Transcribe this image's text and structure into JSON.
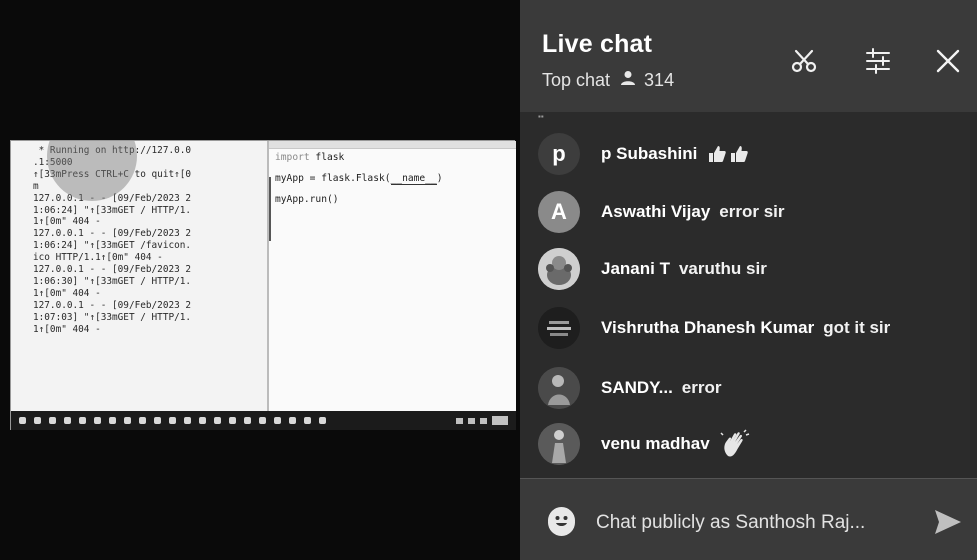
{
  "video": {
    "terminal_lines": [
      " * Running on http://127.0.0",
      ".1:5000",
      "↑[33mPress CTRL+C to quit↑[0",
      "m",
      "127.0.0.1 - - [09/Feb/2023 2",
      "1:06:24] \"↑[33mGET / HTTP/1.",
      "1↑[0m\" 404 -",
      "127.0.0.1 - - [09/Feb/2023 2",
      "1:06:24] \"↑[33mGET /favicon.",
      "ico HTTP/1.1↑[0m\" 404 -",
      "127.0.0.1 - - [09/Feb/2023 2",
      "1:06:30] \"↑[33mGET / HTTP/1.",
      "1↑[0m\" 404 -",
      "127.0.0.1 - - [09/Feb/2023 2",
      "1:07:03] \"↑[33mGET / HTTP/1.",
      "1↑[0m\" 404 -"
    ],
    "code": {
      "line1_keyword": "import",
      "line1_rest": " flask",
      "line2_prefix": "myApp = flask.Flask(",
      "line2_arg": "__name__",
      "line2_suffix": ")",
      "line3": "myApp.run()"
    }
  },
  "chat": {
    "title": "Live chat",
    "mode_label": "Top chat",
    "viewer_count": "314",
    "header_icons": [
      "scissors-icon",
      "settings-sliders-icon",
      "close-icon"
    ],
    "messages": [
      {
        "author": "p Subashini",
        "text": "",
        "avatar_letter": "p",
        "avatar_color": "#3d3d3d",
        "emoji": [
          "thumbs-up",
          "thumbs-up"
        ]
      },
      {
        "author": "Aswathi Vijay",
        "text": "error sir",
        "avatar_letter": "A",
        "avatar_color": "#8a8a8a",
        "emoji": []
      },
      {
        "author": "Janani T",
        "text": "varuthu sir",
        "avatar_letter": "",
        "avatar_color": "#cfcfcf",
        "emoji": []
      },
      {
        "author": "Vishrutha Dhanesh Kumar",
        "text": "got it sir",
        "avatar_letter": "",
        "avatar_color": "#1e1e1e",
        "emoji": []
      },
      {
        "author": "SANDY...",
        "text": "error",
        "avatar_letter": "",
        "avatar_color": "#4a4a4a",
        "emoji": []
      },
      {
        "author": "venu madhav",
        "text": "",
        "avatar_letter": "",
        "avatar_color": "#5a5a5a",
        "emoji": [
          "waving-hand"
        ]
      }
    ],
    "input": {
      "placeholder": "Chat publicly as Santhosh Raj..."
    }
  }
}
